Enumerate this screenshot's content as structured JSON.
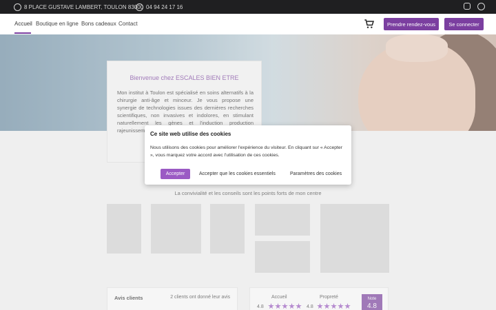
{
  "topbar": {
    "address": "8 PLACE GUSTAVE LAMBERT, TOULON 83000",
    "phone": "04 94 24 17 16",
    "social": [
      "instagram-icon",
      "facebook-icon"
    ]
  },
  "nav": {
    "items": [
      "Accueil",
      "Boutique en ligne",
      "Bons cadeaux",
      "Contact"
    ],
    "cta_appointment": "Prendre rendez-vous",
    "cta_login": "Se connecter"
  },
  "welcome": {
    "title": "Bienvenue chez ESCALES BIEN ETRE",
    "text": "Mon institut à Toulon est spécialisé en soins alternatifs à la chirurgie anti-âge et minceur. Je vous propose une synergie de technologies issues des dernières recherches scientifiques, non invasives et indolores, en stimulant naturellement les gènes et l'induction production rajeunissem"
  },
  "cookie": {
    "title": "Ce site web utilise des cookies",
    "text": "Nous utilisons des cookies pour améliorer l'expérience du visiteur. En cliquant sur « Accepter », vous marquez votre accord avec l'utilisation de ces cookies.",
    "accept": "Accepter",
    "essential": "Accepter que les cookies essentiels",
    "settings": "Paramètres des cookies"
  },
  "tagline": "La convivialité et les conseils sont les points forts de mon centre",
  "reviews": {
    "title": "Avis clients",
    "count": "2 clients ont donné leur avis"
  },
  "ratings": {
    "items": [
      {
        "label": "Accueil",
        "value": "4.8",
        "stars": 5
      },
      {
        "label": "Propreté",
        "value": "4.8",
        "stars": 5
      }
    ],
    "note_label": "Note",
    "note_value": "4.8"
  },
  "colors": {
    "accent": "#7b3fa0",
    "topbar": "#1f1f21"
  }
}
